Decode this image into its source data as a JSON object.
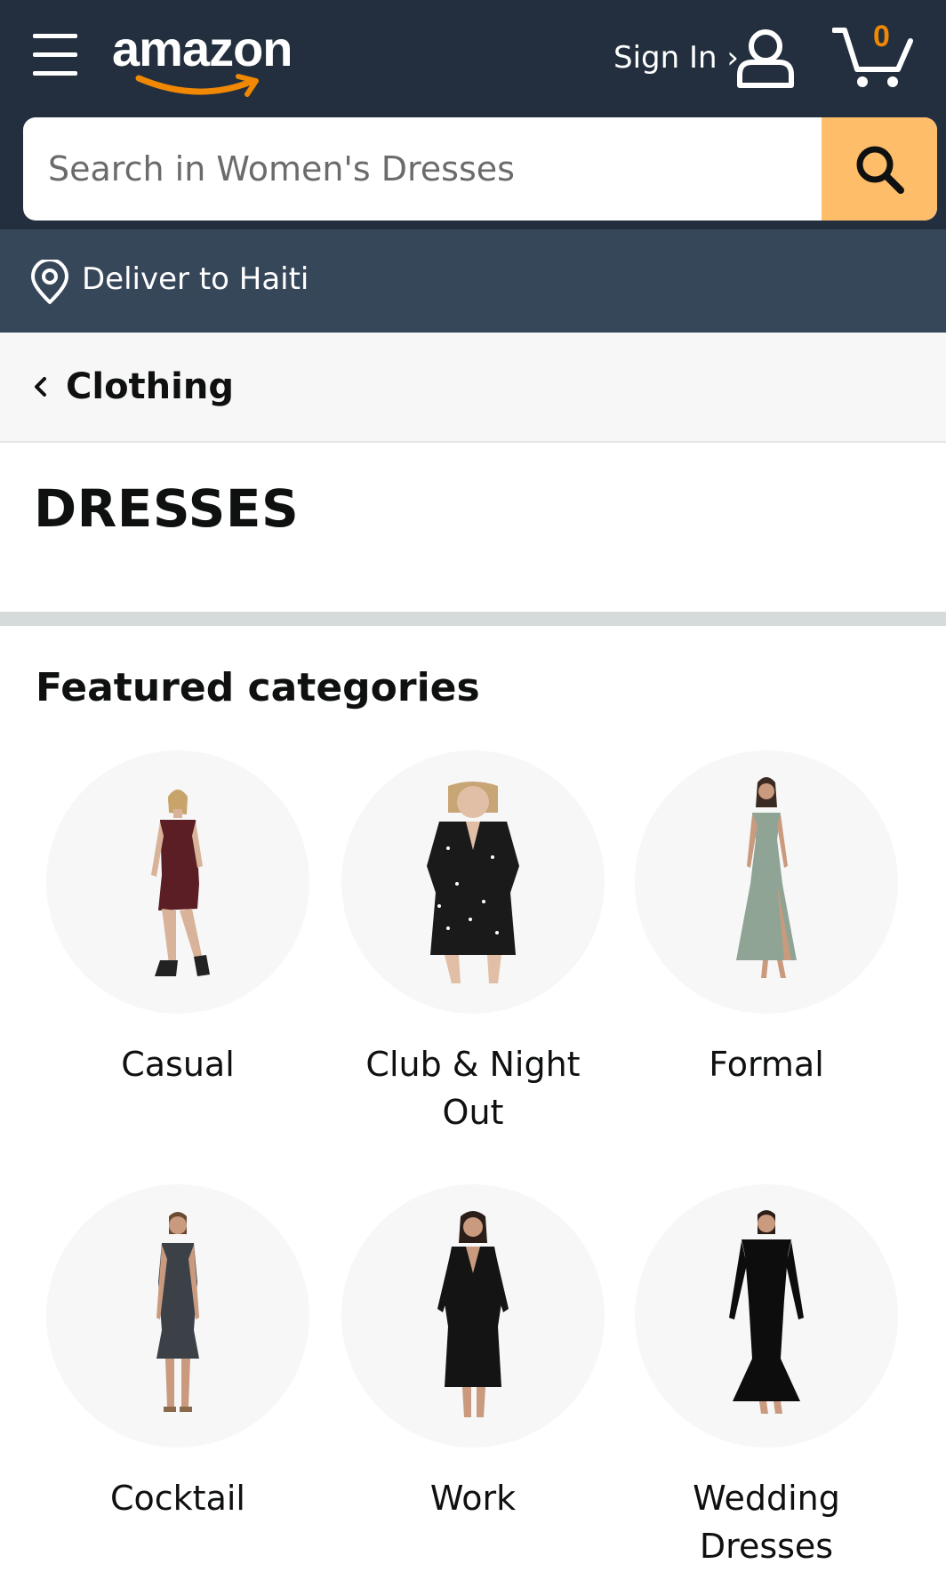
{
  "header": {
    "logo_text": "amazon",
    "signin_label": "Sign In ›",
    "cart_count": "0",
    "brand_accent": "#f08804",
    "bg_color": "#232f3e"
  },
  "search": {
    "placeholder": "Search in Women's Dresses",
    "value": "",
    "button_color": "#febd69"
  },
  "delivery": {
    "label": "Deliver to Haiti"
  },
  "breadcrumb": {
    "label": "Clothing"
  },
  "page": {
    "title": "DRESSES"
  },
  "featured": {
    "title": "Featured categories",
    "categories": [
      {
        "label": "Casual",
        "dress_color": "#5a1e24"
      },
      {
        "label": "Club & Night Out",
        "dress_color": "#1a1a1a"
      },
      {
        "label": "Formal",
        "dress_color": "#8fa494"
      },
      {
        "label": "Cocktail",
        "dress_color": "#3c4148"
      },
      {
        "label": "Work",
        "dress_color": "#141414"
      },
      {
        "label": "Wedding Dresses",
        "dress_color": "#0d0d0d"
      }
    ]
  }
}
